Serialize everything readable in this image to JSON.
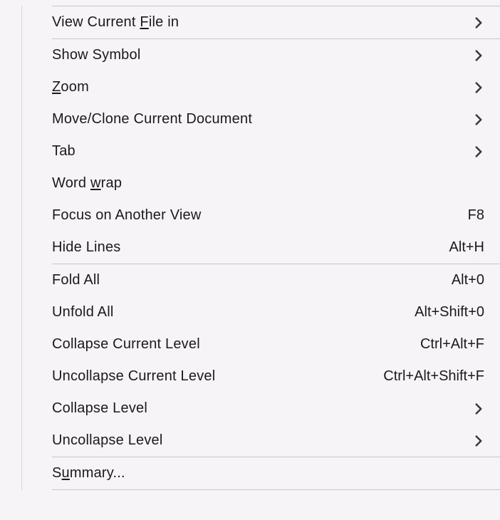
{
  "menu": {
    "items": [
      {
        "label": "View Current File in",
        "underline": "F",
        "submenu": true,
        "shortcut": ""
      },
      {
        "separator": true
      },
      {
        "label": "Show Symbol",
        "underline": "",
        "submenu": true,
        "shortcut": ""
      },
      {
        "label": "Zoom",
        "underline": "Z",
        "submenu": true,
        "shortcut": ""
      },
      {
        "label": "Move/Clone Current Document",
        "underline": "",
        "submenu": true,
        "shortcut": ""
      },
      {
        "label": "Tab",
        "underline": "",
        "submenu": true,
        "shortcut": ""
      },
      {
        "label": "Word wrap",
        "underline": "w",
        "submenu": false,
        "shortcut": ""
      },
      {
        "label": "Focus on Another View",
        "underline": "",
        "submenu": false,
        "shortcut": "F8"
      },
      {
        "label": "Hide Lines",
        "underline": "",
        "submenu": false,
        "shortcut": "Alt+H"
      },
      {
        "separator": true
      },
      {
        "label": "Fold All",
        "underline": "",
        "submenu": false,
        "shortcut": "Alt+0"
      },
      {
        "label": "Unfold All",
        "underline": "",
        "submenu": false,
        "shortcut": "Alt+Shift+0"
      },
      {
        "label": "Collapse Current Level",
        "underline": "",
        "submenu": false,
        "shortcut": "Ctrl+Alt+F"
      },
      {
        "label": "Uncollapse Current Level",
        "underline": "",
        "submenu": false,
        "shortcut": "Ctrl+Alt+Shift+F"
      },
      {
        "label": "Collapse Level",
        "underline": "",
        "submenu": true,
        "shortcut": ""
      },
      {
        "label": "Uncollapse Level",
        "underline": "",
        "submenu": true,
        "shortcut": ""
      },
      {
        "separator": true
      },
      {
        "label": "Summary...",
        "underline": "u",
        "submenu": false,
        "shortcut": ""
      },
      {
        "separator": true
      }
    ]
  }
}
